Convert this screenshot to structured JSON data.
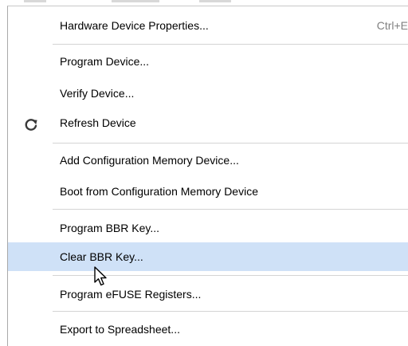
{
  "menu": {
    "items": [
      {
        "label": "Hardware Device Properties...",
        "shortcut": "Ctrl+E"
      },
      {
        "label": "Program Device..."
      },
      {
        "label": "Verify Device..."
      },
      {
        "label": "Refresh Device",
        "icon": "refresh-icon"
      },
      {
        "label": "Add Configuration Memory Device..."
      },
      {
        "label": "Boot from Configuration Memory Device"
      },
      {
        "label": "Program BBR Key..."
      },
      {
        "label": "Clear BBR Key...",
        "state": "hovered"
      },
      {
        "label": "Program eFUSE Registers..."
      },
      {
        "label": "Export to Spreadsheet..."
      }
    ]
  },
  "colors": {
    "hover_background": "#cfe1f7",
    "icon_color": "#3a3a3a",
    "shortcut_color": "#808080",
    "separator": "#d4d4d4"
  },
  "pointer": {
    "icon": "mouse-pointer-icon"
  }
}
